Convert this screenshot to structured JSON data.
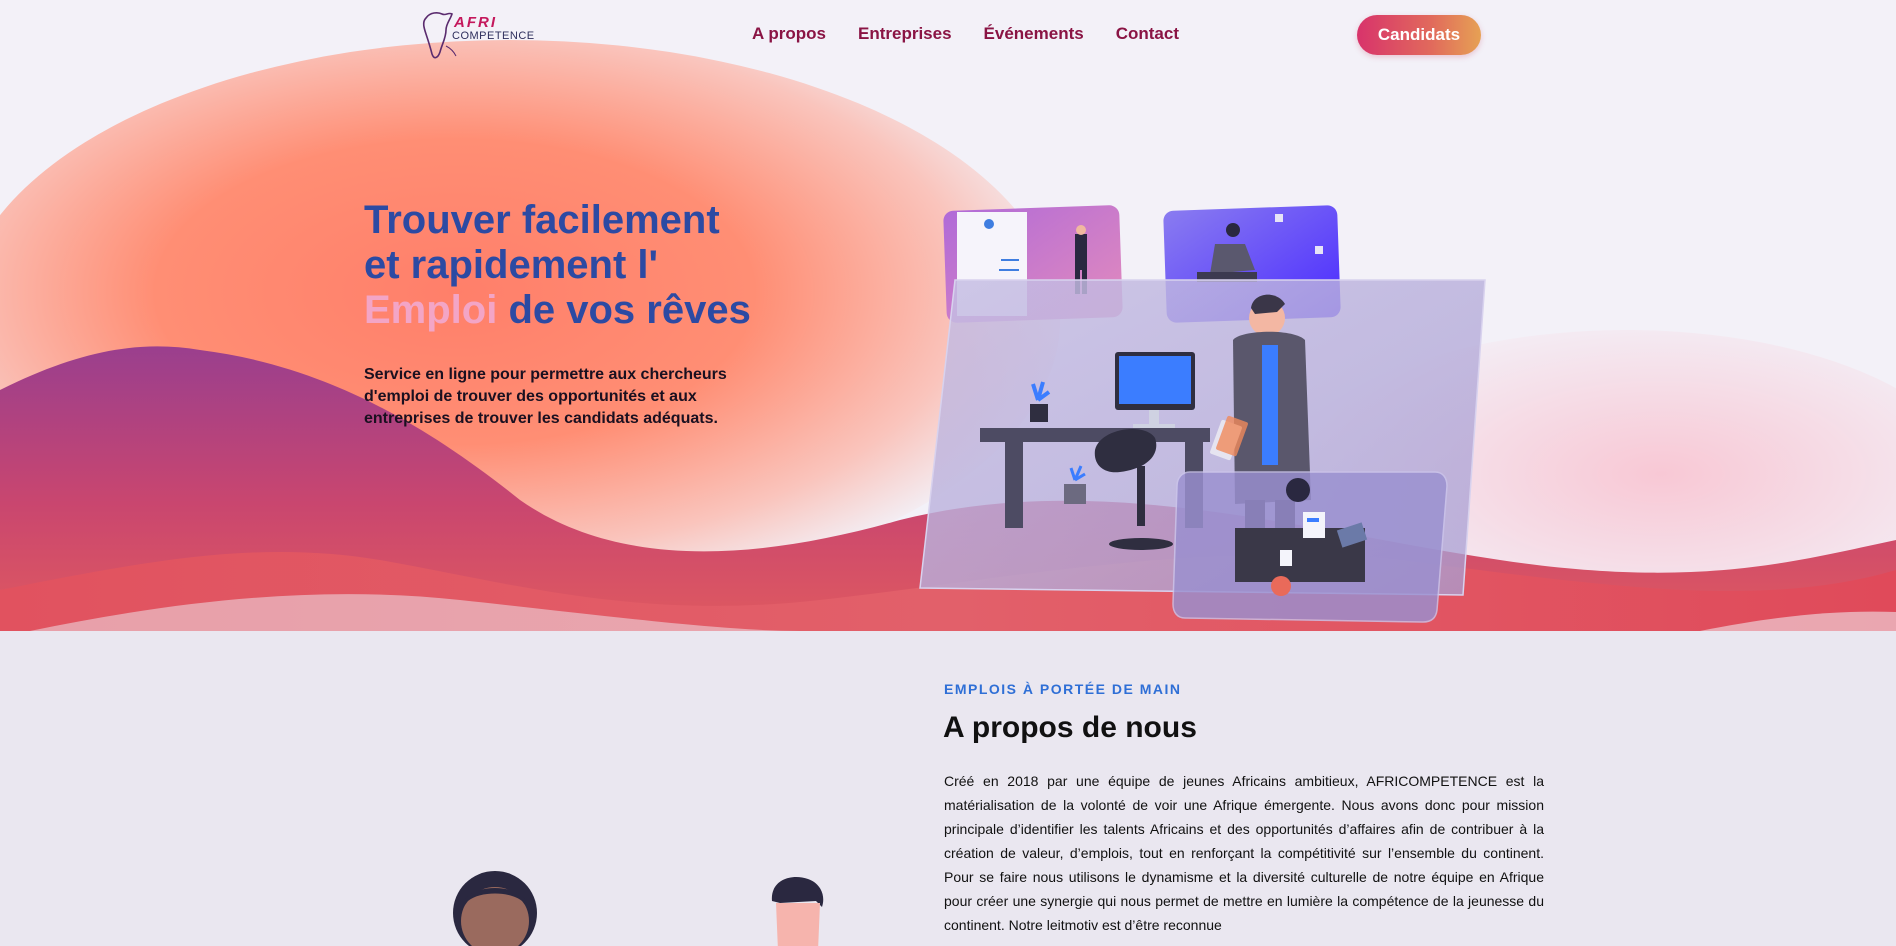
{
  "brand": {
    "logo_line1": "AFRI",
    "logo_line2": "COMPETENCE"
  },
  "nav": {
    "links": [
      "A propos",
      "Entreprises",
      "Événements",
      "Contact"
    ],
    "cta": "Candidats"
  },
  "hero": {
    "title_line1": "Trouver facilement",
    "title_line2": "et rapidement l'",
    "title_accent": "Emploi",
    "title_rest": " de vos rêves",
    "description": "Service en ligne pour permettre aux chercheurs d'emploi de trouver des opportunités et aux entreprises de trouver les candidats adéquats."
  },
  "about": {
    "eyebrow": "EMPLOIS À PORTÉE DE MAIN",
    "title": "A propos de nous",
    "text": "Créé en 2018 par une équipe de jeunes Africains ambitieux, AFRICOMPETENCE est la matérialisation de la volonté de voir une Afrique émergente. Nous avons donc pour mission principale d’identifier les talents Africains et des opportunités d’affaires afin de contribuer à la création de valeur, d’emplois, tout en renforçant la compétitivité sur l’ensemble du continent. Pour se faire nous utilisons le dynamisme et la diversité culturelle de notre équipe en Afrique pour créer une synergie qui nous permet de mettre en lumière la compétence de la jeunesse du continent. Notre leitmotiv est d’être reconnue"
  },
  "colors": {
    "nav_link": "#8a1444",
    "title_blue": "#2c4aa3",
    "accent_pink": "#f3a5c6",
    "eyebrow_blue": "#2f6fd6"
  }
}
